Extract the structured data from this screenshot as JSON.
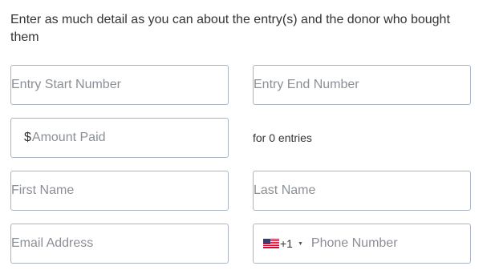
{
  "intro_text": "Enter as much detail as you can about the entry(s) and the donor who bought them",
  "fields": {
    "entry_start": {
      "placeholder": "Entry Start Number",
      "value": ""
    },
    "entry_end": {
      "placeholder": "Entry End Number",
      "value": ""
    },
    "amount": {
      "currency_symbol": "$",
      "placeholder": "Amount Paid",
      "value": ""
    },
    "first_name": {
      "placeholder": "First Name",
      "value": ""
    },
    "last_name": {
      "placeholder": "Last Name",
      "value": ""
    },
    "email": {
      "placeholder": "Email Address",
      "value": ""
    },
    "phone": {
      "country_icon": "us-flag-icon",
      "dial_code": "+1",
      "placeholder": "Phone Number",
      "value": ""
    }
  },
  "entries_note": "for 0 entries",
  "colors": {
    "border": "#a9b4c4",
    "placeholder": "#8b8f96",
    "text": "#333333"
  }
}
